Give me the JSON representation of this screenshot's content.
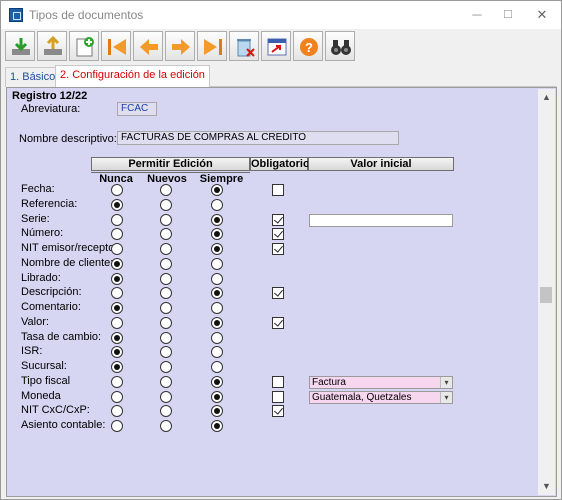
{
  "window": {
    "title": "Tipos de documentos",
    "minimize": "─",
    "maximize": "☐",
    "close": "✕"
  },
  "toolbar": {
    "buttons": [
      "import",
      "export",
      "new",
      "first",
      "previous",
      "next",
      "last",
      "delete",
      "report",
      "help",
      "find"
    ]
  },
  "tabs": [
    {
      "label": "1. Básicos"
    },
    {
      "label": "2. Configuración de la edición"
    }
  ],
  "panel": {
    "registro": "Registro 12/22",
    "abreviatura_label": "Abreviatura:",
    "abreviatura_value": "FCAC",
    "nombre_label": "Nombre descriptivo:",
    "nombre_value": "FACTURAS DE COMPRAS AL CREDITO"
  },
  "grid": {
    "header_permitir": "Permitir Edición",
    "header_obligatorio": "Obligatorio",
    "header_valor": "Valor inicial",
    "col_nunca": "Nunca",
    "col_nuevos": "Nuevos",
    "col_siempre": "Siempre",
    "rows": [
      {
        "label": "Fecha:",
        "edit": "siempre",
        "obligatorio_checkbox": true,
        "obligatorio": false
      },
      {
        "label": "Referencia:",
        "edit": "nunca",
        "obligatorio_checkbox": false,
        "obligatorio": false
      },
      {
        "label": "Serie:",
        "edit": "siempre",
        "obligatorio_checkbox": true,
        "obligatorio": true,
        "valor": "input"
      },
      {
        "label": "Número:",
        "edit": "siempre",
        "obligatorio_checkbox": true,
        "obligatorio": true
      },
      {
        "label": "NIT emisor/receptor:",
        "edit": "siempre",
        "obligatorio_checkbox": true,
        "obligatorio": true
      },
      {
        "label": "Nombre de cliente:",
        "edit": "nunca",
        "obligatorio_checkbox": false,
        "obligatorio": false
      },
      {
        "label": "Librado:",
        "edit": "nunca",
        "obligatorio_checkbox": false,
        "obligatorio": false
      },
      {
        "label": "Descripción:",
        "edit": "siempre",
        "obligatorio_checkbox": true,
        "obligatorio": true
      },
      {
        "label": "Comentario:",
        "edit": "nunca",
        "obligatorio_checkbox": false,
        "obligatorio": false
      },
      {
        "label": "Valor:",
        "edit": "siempre",
        "obligatorio_checkbox": true,
        "obligatorio": true
      },
      {
        "label": "Tasa de cambio:",
        "edit": "nunca",
        "obligatorio_checkbox": false,
        "obligatorio": false
      },
      {
        "label": "ISR:",
        "edit": "nunca",
        "obligatorio_checkbox": false,
        "obligatorio": false
      },
      {
        "label": "Sucursal:",
        "edit": "nunca",
        "obligatorio_checkbox": false,
        "obligatorio": false
      },
      {
        "label": "Tipo fiscal",
        "edit": "siempre",
        "obligatorio_checkbox": true,
        "obligatorio": false,
        "valor": "combo",
        "combo_value": "Factura"
      },
      {
        "label": "Moneda",
        "edit": "siempre",
        "obligatorio_checkbox": true,
        "obligatorio": false,
        "valor": "combo",
        "combo_value": "Guatemala, Quetzales"
      },
      {
        "label": "NIT CxC/CxP:",
        "edit": "siempre",
        "obligatorio_checkbox": true,
        "obligatorio": true
      },
      {
        "label": "Asiento contable:",
        "edit": "siempre",
        "obligatorio_checkbox": false,
        "obligatorio": false
      }
    ]
  },
  "colors": {
    "panel_bg": "#d6d6f2",
    "combo_bg": "#f7d6f0",
    "active_tab": "#d10000",
    "inactive_tab": "#1a4fa3"
  }
}
